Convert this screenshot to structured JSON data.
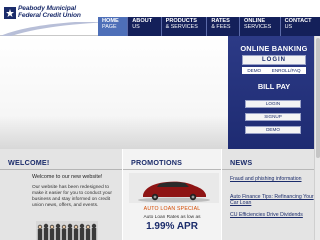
{
  "brand": {
    "line1": "Peabody Municipal",
    "line2": "Federal Credit Union",
    "logo_icon": "star-square-logo"
  },
  "nav": [
    {
      "line1": "HOME",
      "line2": "PAGE"
    },
    {
      "line1": "ABOUT",
      "line2": "US"
    },
    {
      "line1": "PRODUCTS",
      "line2": "& SERVICES"
    },
    {
      "line1": "RATES",
      "line2": "& FEES"
    },
    {
      "line1": "ONLINE",
      "line2": "SERVICES"
    },
    {
      "line1": "CONTACT",
      "line2": "US"
    }
  ],
  "online_banking": {
    "title": "ONLINE BANKING",
    "login_label": "LOGIN",
    "links": [
      "DEMO",
      "ENROLL/FAQ"
    ]
  },
  "bill_pay": {
    "title": "BILL PAY",
    "login_label": "LOGIN",
    "signup_label": "SIGNUP",
    "demo_label": "DEMO"
  },
  "welcome": {
    "heading": "WELCOME!",
    "title": "Welcome to our new website!",
    "body": "Our website has been redesigned to make it easier for you to conduct your business and stay informed on credit union news, offers, and events."
  },
  "promotions": {
    "heading": "PROMOTIONS",
    "caption": "AUTO LOAN SPECIAL",
    "rates_label": "Auto Loan Rates as low as",
    "apr": "1.99% APR"
  },
  "news": {
    "heading": "NEWS",
    "items": [
      "Fraud and phishing information",
      "Auto Finance Tips: Refinancing Your Car Loan",
      "CU Efficiencies Drive Dividends"
    ]
  },
  "colors": {
    "nav_bg": "#14205a",
    "nav_active": "#4e6fb8",
    "brand_blue": "#1b2c6b",
    "promo_orange": "#d44a00"
  }
}
